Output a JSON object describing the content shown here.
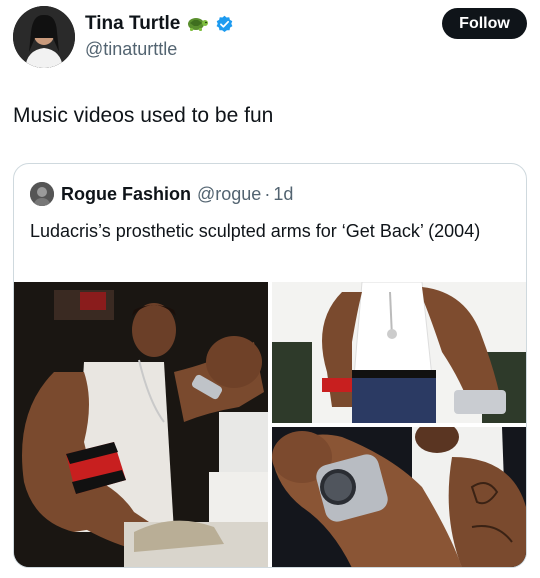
{
  "author": {
    "display_name": "Tina Turtle",
    "handle": "@tinaturttle",
    "emoji_icon": "turtle-icon",
    "verified_icon": "verified-badge-icon"
  },
  "follow_label": "Follow",
  "tweet_text": "Music videos used to be fun",
  "quote": {
    "display_name": "Rogue Fashion",
    "handle": "@rogue",
    "separator": "·",
    "time": "1d",
    "text": "Ludacris’s prosthetic sculpted arms for ‘Get Back’ (2004)",
    "images": [
      "photo-punching-block",
      "photo-arm-watch",
      "photo-watch-closeup"
    ]
  },
  "colors": {
    "text_primary": "#0f1419",
    "text_secondary": "#536471",
    "border": "#cfd9de",
    "verified": "#1d9bf0",
    "follow_bg": "#0f1419"
  }
}
